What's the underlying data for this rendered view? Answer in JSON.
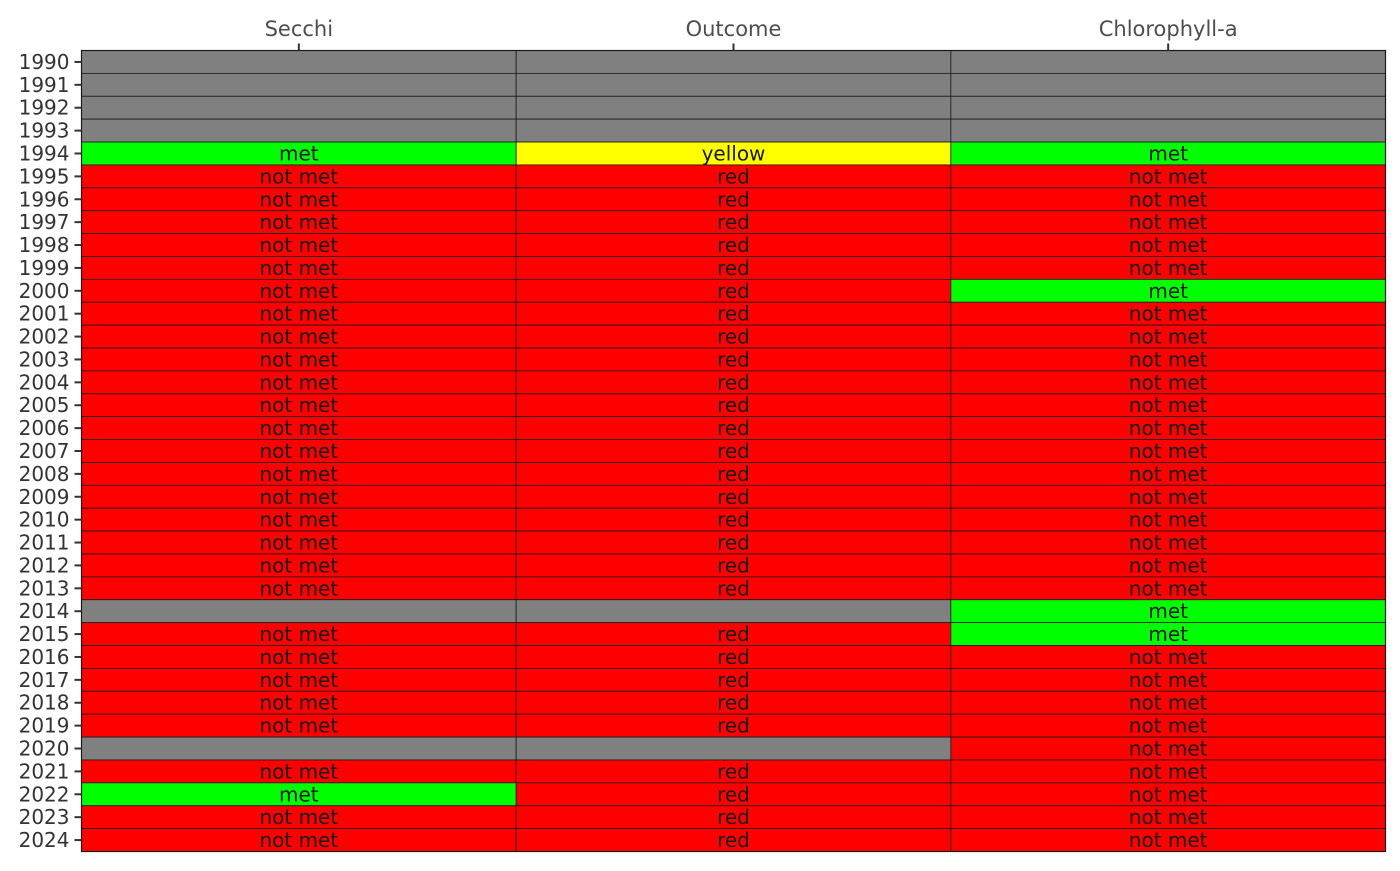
{
  "chart_data": {
    "type": "heatmap",
    "title": "",
    "xlabel": "",
    "ylabel": "",
    "columns": [
      "Secchi",
      "Outcome",
      "Chlorophyll-a"
    ],
    "years": [
      "1990",
      "1991",
      "1992",
      "1993",
      "1994",
      "1995",
      "1996",
      "1997",
      "1998",
      "1999",
      "2000",
      "2001",
      "2002",
      "2003",
      "2004",
      "2005",
      "2006",
      "2007",
      "2008",
      "2009",
      "2010",
      "2011",
      "2012",
      "2013",
      "2014",
      "2015",
      "2016",
      "2017",
      "2018",
      "2019",
      "2020",
      "2021",
      "2022",
      "2023",
      "2024"
    ],
    "cells": [
      [
        "",
        "",
        ""
      ],
      [
        "",
        "",
        ""
      ],
      [
        "",
        "",
        ""
      ],
      [
        "",
        "",
        ""
      ],
      [
        "met",
        "yellow",
        "met"
      ],
      [
        "not met",
        "red",
        "not met"
      ],
      [
        "not met",
        "red",
        "not met"
      ],
      [
        "not met",
        "red",
        "not met"
      ],
      [
        "not met",
        "red",
        "not met"
      ],
      [
        "not met",
        "red",
        "not met"
      ],
      [
        "not met",
        "red",
        "met"
      ],
      [
        "not met",
        "red",
        "not met"
      ],
      [
        "not met",
        "red",
        "not met"
      ],
      [
        "not met",
        "red",
        "not met"
      ],
      [
        "not met",
        "red",
        "not met"
      ],
      [
        "not met",
        "red",
        "not met"
      ],
      [
        "not met",
        "red",
        "not met"
      ],
      [
        "not met",
        "red",
        "not met"
      ],
      [
        "not met",
        "red",
        "not met"
      ],
      [
        "not met",
        "red",
        "not met"
      ],
      [
        "not met",
        "red",
        "not met"
      ],
      [
        "not met",
        "red",
        "not met"
      ],
      [
        "not met",
        "red",
        "not met"
      ],
      [
        "not met",
        "red",
        "not met"
      ],
      [
        "",
        "",
        "met"
      ],
      [
        "not met",
        "red",
        "met"
      ],
      [
        "not met",
        "red",
        "not met"
      ],
      [
        "not met",
        "red",
        "not met"
      ],
      [
        "not met",
        "red",
        "not met"
      ],
      [
        "not met",
        "red",
        "not met"
      ],
      [
        "",
        "",
        "not met"
      ],
      [
        "not met",
        "red",
        "not met"
      ],
      [
        "met",
        "red",
        "not met"
      ],
      [
        "not met",
        "red",
        "not met"
      ],
      [
        "not met",
        "red",
        "not met"
      ]
    ],
    "colors": {
      "met": "#00ff00",
      "not met": "#ff0000",
      "yellow": "#ffff00",
      "red": "#ff0000",
      "": "#808080"
    },
    "grid": true,
    "legend": "none"
  }
}
